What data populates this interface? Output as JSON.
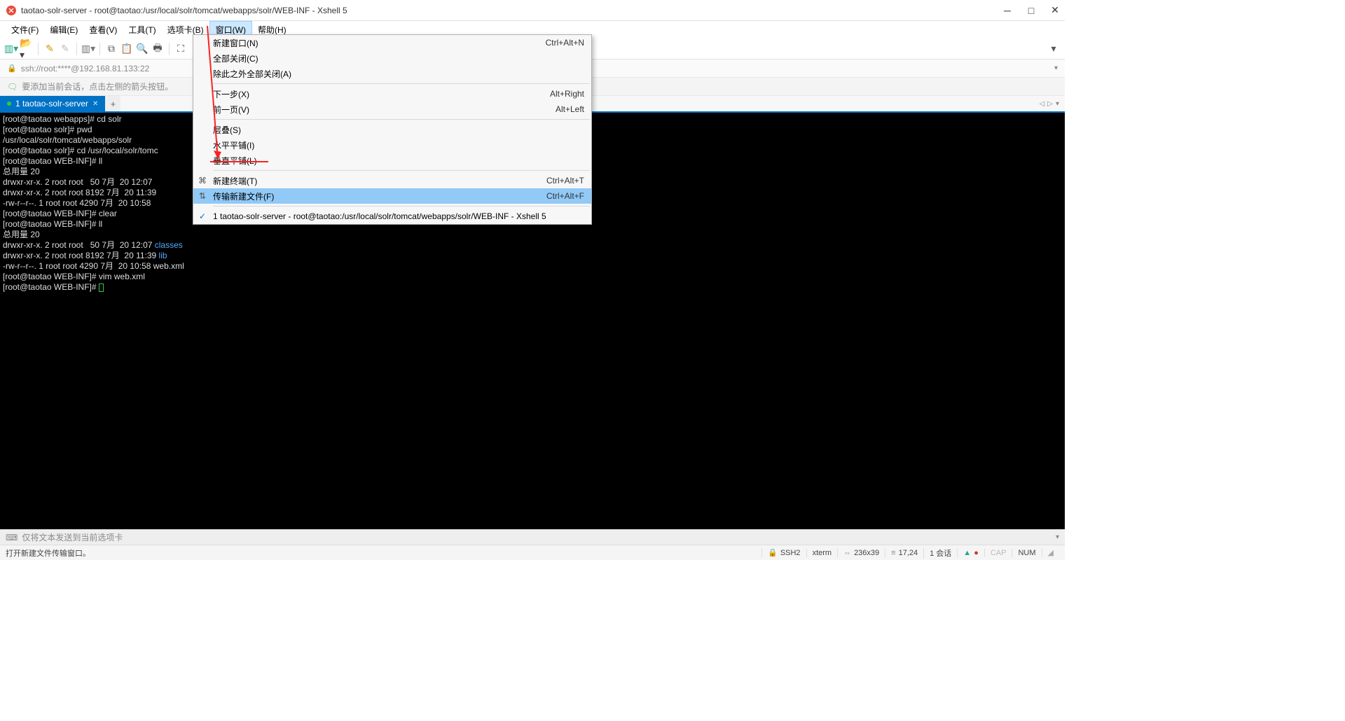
{
  "titlebar": {
    "title": "taotao-solr-server - root@taotao:/usr/local/solr/tomcat/webapps/solr/WEB-INF - Xshell 5"
  },
  "menubar": {
    "items": [
      "文件(F)",
      "编辑(E)",
      "查看(V)",
      "工具(T)",
      "选项卡(B)",
      "窗口(W)",
      "帮助(H)"
    ],
    "active_index": 5
  },
  "addressbar": {
    "text": "ssh://root:****@192.168.81.133:22"
  },
  "hintbar": {
    "text": "要添加当前会话，点击左侧的箭头按钮。"
  },
  "tab": {
    "label": "1 taotao-solr-server"
  },
  "dropdown": {
    "items": [
      {
        "label": "新建窗口(N)",
        "shortcut": "Ctrl+Alt+N",
        "icon": ""
      },
      {
        "label": "全部关闭(C)",
        "shortcut": "",
        "icon": ""
      },
      {
        "label": "除此之外全部关闭(A)",
        "shortcut": "",
        "icon": ""
      },
      {
        "sep": true
      },
      {
        "label": "下一步(X)",
        "shortcut": "Alt+Right",
        "icon": ""
      },
      {
        "label": "前一页(V)",
        "shortcut": "Alt+Left",
        "icon": ""
      },
      {
        "sep": true
      },
      {
        "label": "层叠(S)",
        "shortcut": "",
        "icon": ""
      },
      {
        "label": "水平平铺(I)",
        "shortcut": "",
        "icon": ""
      },
      {
        "label": "垂直平铺(L)",
        "shortcut": "",
        "icon": ""
      },
      {
        "sep": true
      },
      {
        "label": "新建终端(T)",
        "shortcut": "Ctrl+Alt+T",
        "icon": "⌘"
      },
      {
        "label": "传输新建文件(F)",
        "shortcut": "Ctrl+Alt+F",
        "icon": "⇅",
        "hover": true
      },
      {
        "sep": true
      },
      {
        "label": "1 taotao-solr-server - root@taotao:/usr/local/solr/tomcat/webapps/solr/WEB-INF - Xshell 5",
        "shortcut": "",
        "current": true
      }
    ]
  },
  "terminal": {
    "lines": [
      {
        "t": "[root@taotao webapps]# cd solr"
      },
      {
        "t": "[root@taotao solr]# pwd"
      },
      {
        "t": "/usr/local/solr/tomcat/webapps/solr"
      },
      {
        "t": "[root@taotao solr]# cd /usr/local/solr/tomc"
      },
      {
        "t": "[root@taotao WEB-INF]# ll"
      },
      {
        "t": "总用量 20"
      },
      {
        "t": "drwxr-xr-x. 2 root root   50 7月  20 12:07"
      },
      {
        "t": "drwxr-xr-x. 2 root root 8192 7月  20 11:39"
      },
      {
        "t": "-rw-r--r--. 1 root root 4290 7月  20 10:58"
      },
      {
        "t": "[root@taotao WEB-INF]# clear"
      },
      {
        "t": "[root@taotao WEB-INF]# ll"
      },
      {
        "t": "总用量 20"
      },
      {
        "t": "drwxr-xr-x. 2 root root   50 7月  20 12:07 ",
        "tail": "classes",
        "cls": "cyan"
      },
      {
        "t": "drwxr-xr-x. 2 root root 8192 7月  20 11:39 ",
        "tail": "lib",
        "cls": "cyan"
      },
      {
        "t": "-rw-r--r--. 1 root root 4290 7月  20 10:58 web.xml"
      },
      {
        "t": "[root@taotao WEB-INF]# vim web.xml"
      },
      {
        "t": "[root@taotao WEB-INF]# ",
        "cursor": true
      }
    ]
  },
  "sendbar": {
    "placeholder": "仅将文本发送到当前选项卡"
  },
  "statusbar": {
    "left": "打开新建文件传输窗口。",
    "ssh": "SSH2",
    "term": "xterm",
    "size": "236x39",
    "pos": "17,24",
    "sessions": "1 会话",
    "caps": "CAP",
    "num": "NUM"
  }
}
